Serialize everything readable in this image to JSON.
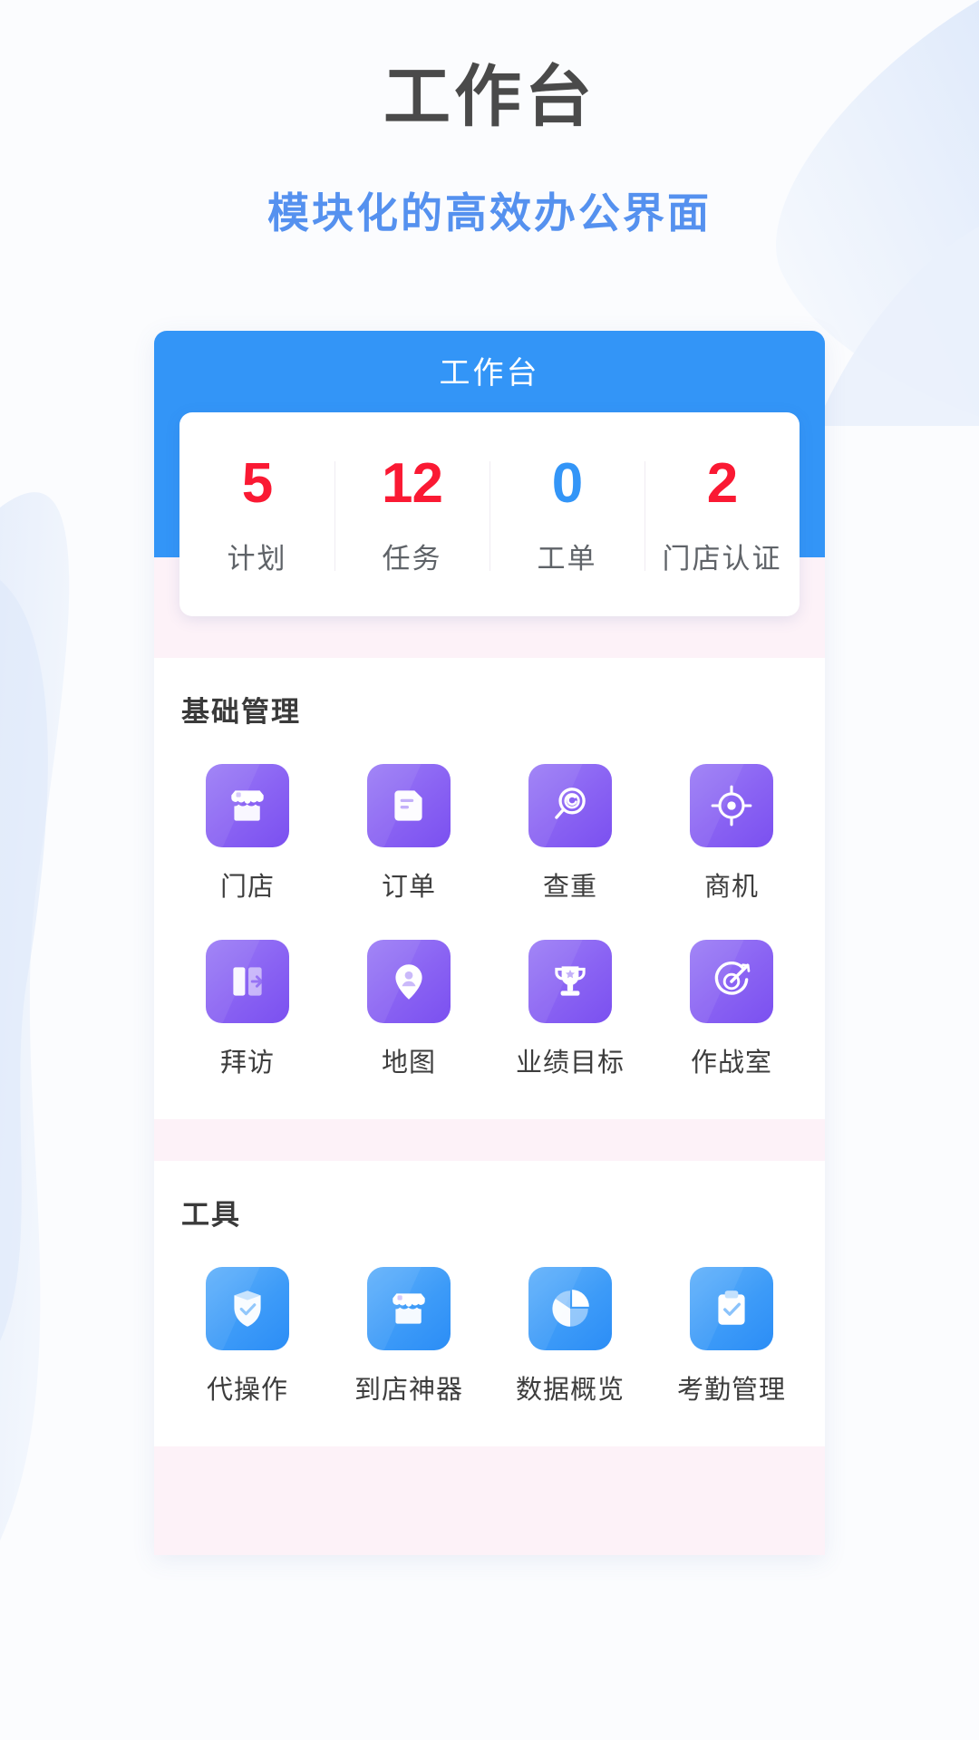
{
  "page": {
    "title": "工作台",
    "subtitle": "模块化的高效办公界面"
  },
  "colors": {
    "brand_blue": "#3395f7",
    "subtitle_blue": "#5591ef",
    "stat_red": "#fa1933",
    "stat_blue": "#3395f7",
    "tile_purple": "#8a63f3",
    "tile_blue": "#3d9bf8",
    "panel_gap_pink": "#fdf2f8"
  },
  "app": {
    "bar_title": "工作台",
    "stats": [
      {
        "value": "5",
        "label": "计划",
        "color": "red"
      },
      {
        "value": "12",
        "label": "任务",
        "color": "red"
      },
      {
        "value": "0",
        "label": "工单",
        "color": "blue"
      },
      {
        "value": "2",
        "label": "门店认证",
        "color": "red"
      }
    ],
    "sections": [
      {
        "title": "基础管理",
        "tone": "purple",
        "items": [
          {
            "label": "门店",
            "icon": "store-icon"
          },
          {
            "label": "订单",
            "icon": "order-document-icon"
          },
          {
            "label": "查重",
            "icon": "magnifier-spiral-icon"
          },
          {
            "label": "商机",
            "icon": "target-crosshair-icon"
          },
          {
            "label": "拜访",
            "icon": "door-enter-icon"
          },
          {
            "label": "地图",
            "icon": "map-pin-person-icon"
          },
          {
            "label": "业绩目标",
            "icon": "trophy-icon"
          },
          {
            "label": "作战室",
            "icon": "dart-board-icon"
          }
        ]
      },
      {
        "title": "工具",
        "tone": "blue",
        "items": [
          {
            "label": "代操作",
            "icon": "shield-check-icon"
          },
          {
            "label": "到店神器",
            "icon": "store-icon"
          },
          {
            "label": "数据概览",
            "icon": "pie-chart-icon"
          },
          {
            "label": "考勤管理",
            "icon": "clipboard-check-icon"
          }
        ]
      }
    ]
  }
}
